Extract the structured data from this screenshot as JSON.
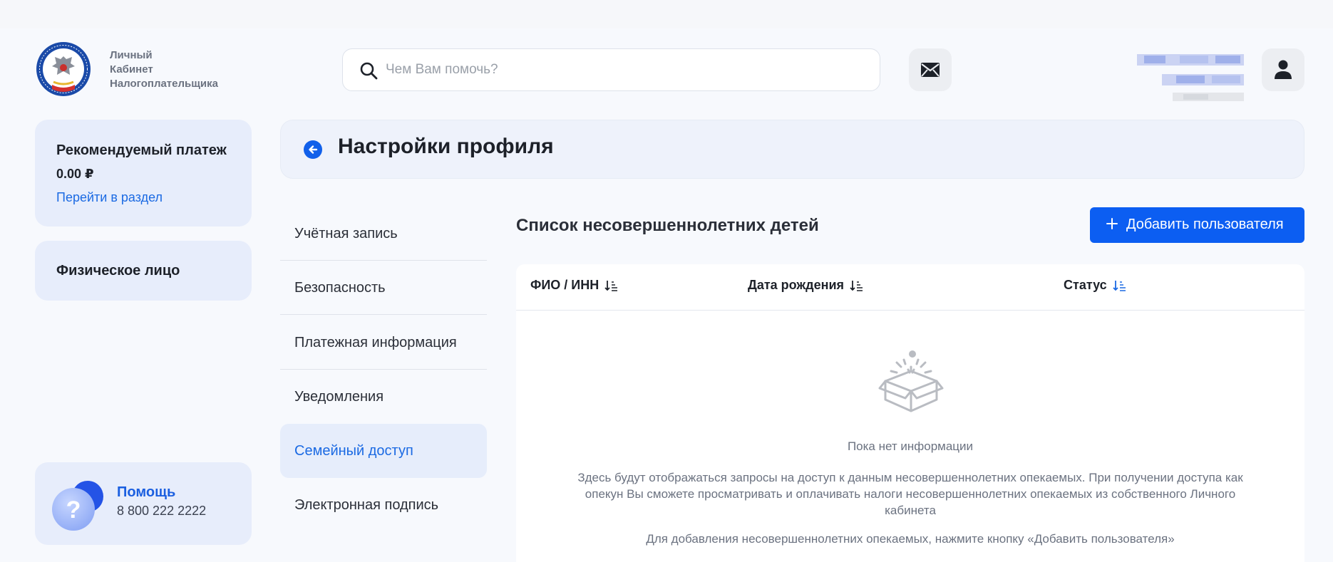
{
  "header": {
    "brand_lines": [
      "Личный",
      "Кабинет",
      "Налогоплательщика"
    ],
    "search": {
      "placeholder": "Чем Вам помочь?",
      "value": ""
    },
    "icons": {
      "search": "search-icon",
      "mail": "envelope-icon",
      "user": "user-icon",
      "logo": "fns-emblem-logo"
    }
  },
  "sidebar": {
    "payment": {
      "title": "Рекомендуемый платеж",
      "amount": "0.00 ₽",
      "link": "Перейти в раздел"
    },
    "person": {
      "title": "Физическое лицо"
    },
    "help": {
      "title": "Помощь",
      "phone": "8 800 222 2222"
    }
  },
  "profile": {
    "title": "Настройки профиля"
  },
  "menu": {
    "items": [
      {
        "label": "Учётная запись"
      },
      {
        "label": "Безопасность"
      },
      {
        "label": "Платежная информация"
      },
      {
        "label": "Уведомления"
      },
      {
        "label": "Семейный доступ",
        "active": true
      },
      {
        "label": "Электронная подпись"
      }
    ]
  },
  "main": {
    "section_title": "Список несовершеннолетних детей",
    "add_button": "Добавить пользователя",
    "table": {
      "columns": [
        "ФИО / ИНН",
        "Дата рождения",
        "Статус"
      ],
      "rows": []
    },
    "empty": {
      "title": "Пока нет информации",
      "description": "Здесь будут отображаться запросы на доступ к данным несовершеннолетних опекаемых. При получении доступа как опекун Вы сможете просматривать и оплачивать налоги несовершеннолетних опекаемых из собственного Личного кабинета",
      "hint": "Для добавления несовершеннолетних опекаемых, нажмите кнопку «Добавить пользователя»"
    }
  },
  "colors": {
    "accent": "#0c5ef2",
    "link": "#1b6ae3",
    "card_bg": "#e7edfb",
    "active_sort": "#1b6ae3"
  }
}
